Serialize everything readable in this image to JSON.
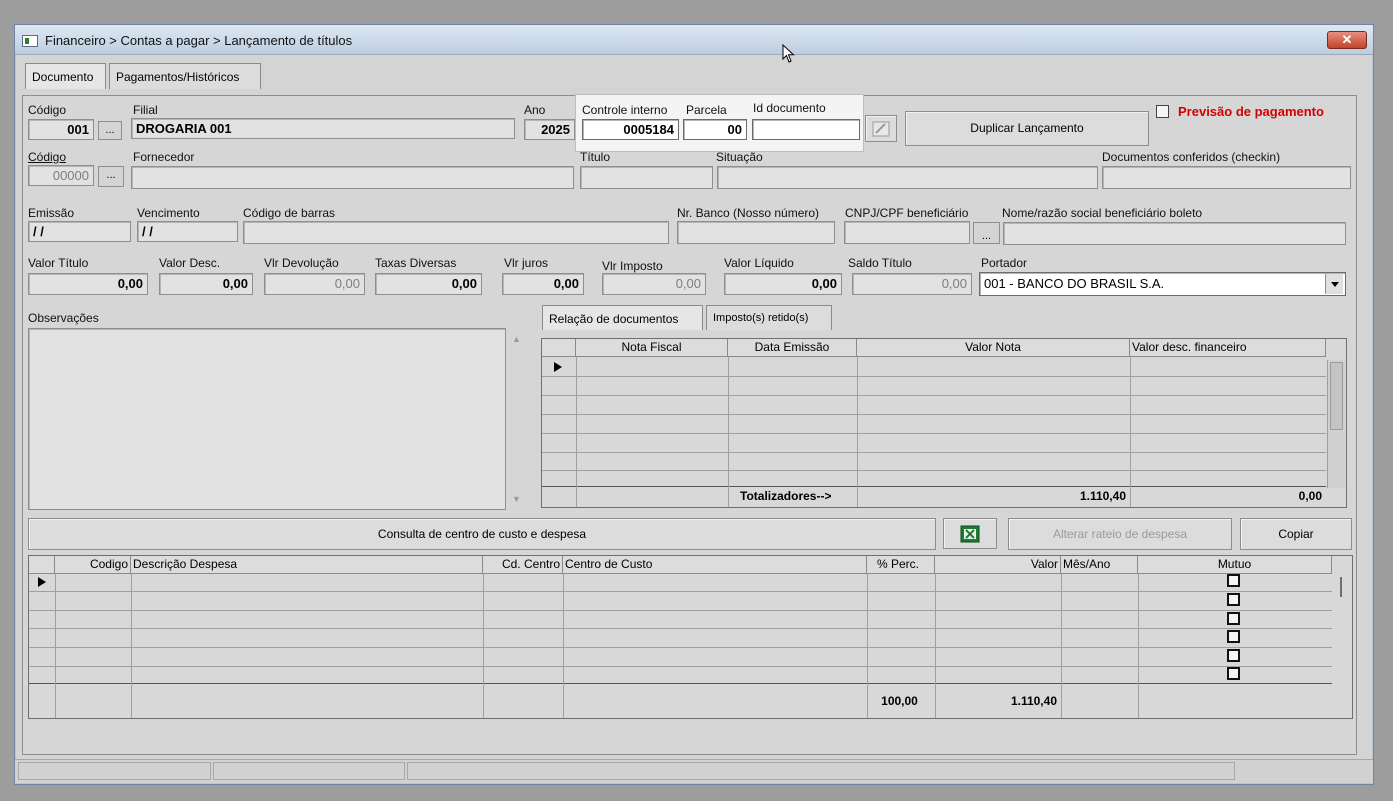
{
  "window": {
    "title": "Financeiro > Contas a pagar > Lançamento de títulos",
    "close_label": "✕"
  },
  "tabs": [
    {
      "label": "Documento"
    },
    {
      "label": "Pagamentos/Históricos"
    }
  ],
  "header": {
    "codigo_label": "Código",
    "codigo_value": "001",
    "filial_label": "Filial",
    "filial_value": "DROGARIA 001",
    "ano_label": "Ano",
    "ano_value": "2025",
    "controle_label": "Controle interno",
    "controle_value": "0005184",
    "parcela_label": "Parcela",
    "parcela_value": "00",
    "iddoc_label": "Id documento",
    "iddoc_value": "",
    "duplicar_label": "Duplicar Lançamento",
    "previsao_label": "Previsão de pagamento",
    "dots": "..."
  },
  "row2": {
    "codigo_label": "Código",
    "codigo_value": "00000",
    "fornecedor_label": "Fornecedor",
    "titulo_label": "Título",
    "situacao_label": "Situação",
    "docs_label": "Documentos conferidos (checkin)"
  },
  "row3": {
    "emissao_label": "Emissão",
    "emissao_value": "/ /",
    "vencimento_label": "Vencimento",
    "vencimento_value": "/ /",
    "barras_label": "Código de barras",
    "nrbanco_label": "Nr. Banco (Nosso número)",
    "cnpj_label": "CNPJ/CPF beneficiário",
    "nome_label": "Nome/razão social beneficiário boleto"
  },
  "row4": {
    "valor_titulo_label": "Valor Título",
    "valor_titulo": "0,00",
    "valor_desc_label": "Valor Desc.",
    "valor_desc": "0,00",
    "vlr_devol_label": "Vlr Devolução",
    "vlr_devol": "0,00",
    "taxas_label": "Taxas Diversas",
    "taxas": "0,00",
    "juros_label": "Vlr juros",
    "juros": "0,00",
    "imposto_label": "Vlr Imposto",
    "imposto": "0,00",
    "liquido_label": "Valor Líquido",
    "liquido": "0,00",
    "saldo_label": "Saldo Título",
    "saldo": "0,00",
    "portador_label": "Portador",
    "portador_value": "001 - BANCO DO BRASIL S.A."
  },
  "observacoes_label": "Observações",
  "doc_tabs": [
    {
      "label": "Relação de documentos"
    },
    {
      "label": "Imposto(s) retido(s)"
    }
  ],
  "doc_grid": {
    "columns": [
      "Nota Fiscal",
      "Data Emissão",
      "Valor Nota",
      "Valor desc. financeiro"
    ],
    "totalizadores_label": "Totalizadores-->",
    "total_valor_nota": "1.110,40",
    "total_desc": "0,00"
  },
  "actions": {
    "consulta_label": "Consulta de centro de custo e despesa",
    "alterar_label": "Alterar rateio de despesa",
    "copiar_label": "Copiar"
  },
  "expense_grid": {
    "columns": [
      "Codigo",
      "Descrição Despesa",
      "Cd. Centro",
      "Centro de Custo",
      "% Perc.",
      "Valor",
      "Mês/Ano",
      "Mutuo"
    ],
    "total_perc": "100,00",
    "total_valor": "1.110,40"
  },
  "colors": {
    "title_gradient_top": "#dfe8f3",
    "previsao_red": "#d40000",
    "excel_green": "#1e7b34"
  }
}
